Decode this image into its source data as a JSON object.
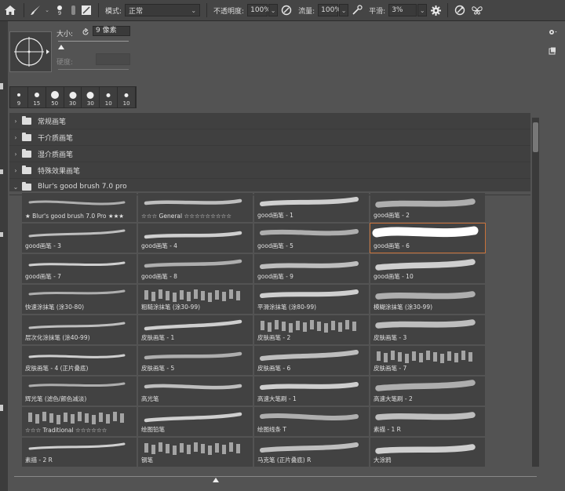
{
  "optbar": {
    "brush_size": "9",
    "mode_label": "模式:",
    "mode_value": "正常",
    "opacity_label": "不透明度:",
    "opacity_value": "100%",
    "flow_label": "流量:",
    "flow_value": "100%",
    "smooth_label": "平滑:",
    "smooth_value": "3%"
  },
  "brush_panel": {
    "size_label": "大小:",
    "size_value": "9 像素",
    "hardness_label": "硬度:"
  },
  "presets": [
    {
      "label": "9"
    },
    {
      "label": "15"
    },
    {
      "label": "50"
    },
    {
      "label": "30"
    },
    {
      "label": "30"
    },
    {
      "label": "10"
    },
    {
      "label": "10"
    }
  ],
  "groups": [
    {
      "label": "常规画笔",
      "expanded": false
    },
    {
      "label": "干介质画笔",
      "expanded": false
    },
    {
      "label": "湿介质画笔",
      "expanded": false
    },
    {
      "label": "特殊效果画笔",
      "expanded": false
    },
    {
      "label": "Blur's good brush 7.0 pro",
      "expanded": true
    }
  ],
  "brushes": [
    "★ Blur's good brush 7.0 Pro ★★★",
    "☆☆☆ General ☆☆☆☆☆☆☆☆☆",
    "good画笔 - 1",
    "good画笔 - 2",
    "good画笔 - 3",
    "good画笔 - 4",
    "good画笔 - 5",
    "good画笔 - 6",
    "good画笔 - 7",
    "good画笔 - 8",
    "good画笔 - 9",
    "good画笔 - 10",
    "快速涂抹笔 (涂30-80)",
    "粗糙涂抹笔 (涂30-99)",
    "平滑涂抹笔 (涂80-99)",
    "模糊涂抹笔 (涂30-99)",
    "层次化涂抹笔 (涂40-99)",
    "皮肤画笔 - 1",
    "皮肤画笔 - 2",
    "皮肤画笔 - 3",
    "皮肤画笔 - 4 (正片叠底)",
    "皮肤画笔 - 5",
    "皮肤画笔 - 6",
    "皮肤画笔 - 7",
    "辉光笔 (滤色/颜色减淡)",
    "高光笔",
    "高速大笔刷 - 1",
    "高速大笔刷 - 2",
    "☆☆☆ Traditional ☆☆☆☆☆☆",
    "绘图铅笔",
    "绘图线条 T",
    "素描 - 1 R",
    "素描 - 2 R",
    "钢笔",
    "马克笔 (正片叠底) R",
    "大涂鸦"
  ],
  "selected_brush_index": 7,
  "colors": {
    "background": "#535353",
    "toolbar": "#454545",
    "list_bg": "#404040",
    "selection": "#c8723a"
  },
  "icons": {
    "home": "home-icon",
    "brush": "brush-icon",
    "brush_panel_toggle": "brush-panel-toggle-icon",
    "airbrush": "airbrush-icon",
    "smoothing": "gear-icon",
    "pressure_size": "pressure-size-icon",
    "symmetry": "butterfly-icon"
  }
}
